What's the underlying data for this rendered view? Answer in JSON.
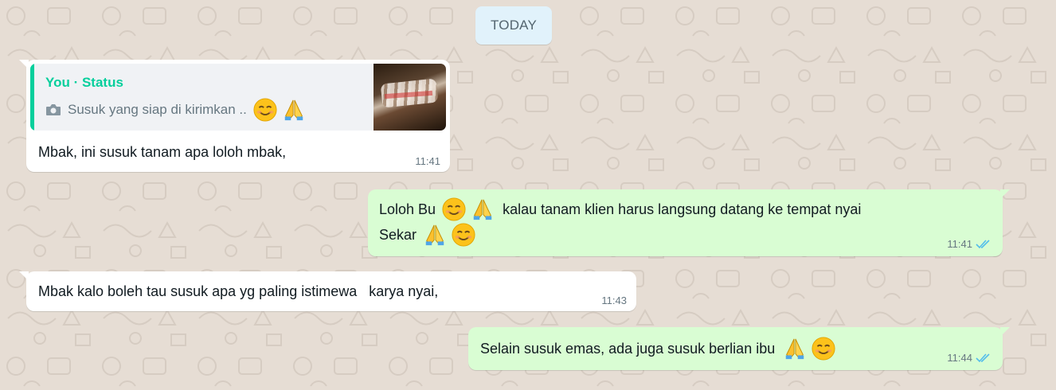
{
  "chat": {
    "date_divider": "TODAY",
    "messages": [
      {
        "direction": "incoming",
        "reply": {
          "author": "You · Status",
          "caption": "Susuk yang siap di kirimkan ..",
          "icon": "camera-icon"
        },
        "text": "Mbak, ini susuk tanam apa loloh mbak,",
        "time": "11:41"
      },
      {
        "direction": "outgoing",
        "line1_a": "Loloh Bu",
        "line1_b": "kalau tanam klien harus langsung datang ke tempat nyai",
        "line2": "Sekar",
        "time": "11:41",
        "status": "read"
      },
      {
        "direction": "incoming",
        "text": "Mbak kalo boleh tau susuk apa yg paling istimewa   karya nyai,",
        "time": "11:43"
      },
      {
        "direction": "outgoing",
        "text": "Selain susuk emas, ada juga susuk berlian ibu",
        "time": "11:44",
        "status": "read"
      }
    ]
  },
  "colors": {
    "wallpaper": "#e6ddd4",
    "incoming_bubble": "#ffffff",
    "outgoing_bubble": "#d9fdd3",
    "accent_green": "#06cf9c",
    "read_tick": "#53bdeb"
  },
  "icons": [
    "smiling-face-icon",
    "folded-hands-icon",
    "camera-icon",
    "double-check-icon"
  ]
}
